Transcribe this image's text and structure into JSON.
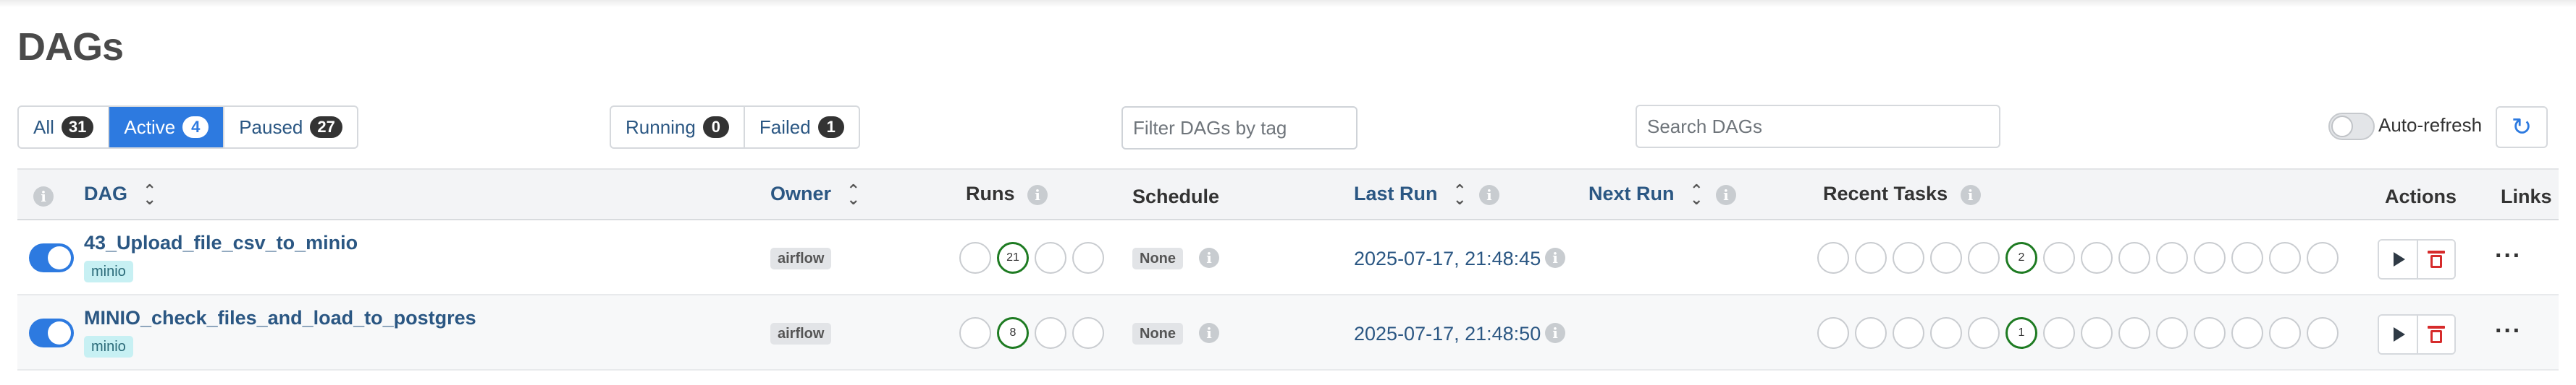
{
  "page": {
    "title": "DAGs"
  },
  "filters": {
    "status_tabs": [
      {
        "label": "All",
        "count": "31",
        "active": false
      },
      {
        "label": "Active",
        "count": "4",
        "active": true
      },
      {
        "label": "Paused",
        "count": "27",
        "active": false
      }
    ],
    "run_tabs": [
      {
        "label": "Running",
        "count": "0"
      },
      {
        "label": "Failed",
        "count": "1"
      }
    ],
    "tag_filter_placeholder": "Filter DAGs by tag",
    "search_placeholder": "Search DAGs",
    "auto_refresh_label": "Auto-refresh",
    "auto_refresh_on": false
  },
  "table": {
    "columns": {
      "dag": "DAG",
      "owner": "Owner",
      "runs": "Runs",
      "schedule": "Schedule",
      "last_run": "Last Run",
      "next_run": "Next Run",
      "recent_tasks": "Recent Tasks",
      "actions": "Actions",
      "links": "Links"
    },
    "rows": [
      {
        "enabled": true,
        "dag_id": "43_Upload_file_csv_to_minio",
        "tag": "minio",
        "owner": "airflow",
        "runs": [
          "",
          "21",
          "",
          ""
        ],
        "schedule": "None",
        "last_run": "2025-07-17, 21:48:45",
        "recent_tasks": [
          "",
          "",
          "",
          "",
          "",
          "2",
          "",
          "",
          "",
          "",
          "",
          "",
          "",
          ""
        ]
      },
      {
        "enabled": true,
        "dag_id": "MINIO_check_files_and_load_to_postgres",
        "tag": "minio",
        "owner": "airflow",
        "runs": [
          "",
          "8",
          "",
          ""
        ],
        "schedule": "None",
        "last_run": "2025-07-17, 21:48:50",
        "recent_tasks": [
          "",
          "",
          "",
          "",
          "",
          "1",
          "",
          "",
          "",
          "",
          "",
          "",
          "",
          ""
        ]
      }
    ]
  },
  "icons": {
    "info": "info-icon",
    "sort": "sort-icon",
    "refresh": "refresh-icon",
    "play": "play-icon",
    "delete": "trash-icon",
    "more": "more-icon"
  },
  "colors": {
    "accent": "#2d7ae0",
    "link": "#2b5783",
    "success_ring": "#1e7b22",
    "delete": "#d62b2b",
    "tag_bg": "#c7f0f3"
  }
}
